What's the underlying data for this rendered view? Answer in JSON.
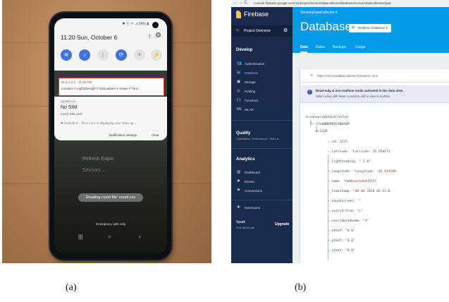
{
  "captions": {
    "a": "(a)",
    "b": "(b)"
  },
  "phone": {
    "status_icons": "✱ ⓝ ᯤ ⊿ 54% ▮",
    "clock": "11:20  Sun, October 6",
    "tiles": [
      "wifi",
      "sound",
      "bluetooth",
      "sync",
      "airplane",
      "flashlight"
    ],
    "notif1_title": "W-w 1.2.1 · 11:05 PM",
    "notif1_text": "Location # LightStrength # Gait pattern # Swipe # Touc...",
    "notif2_source": "System UI",
    "notif2_title": "No SIM",
    "notif2_text": "Insert SIM card",
    "notif3_text": "✱ Android S...   W-w 1.2.1 is displaying over other ap...",
    "notif_settings": "Notification settings",
    "clear": "Clear",
    "bg_text_1": "Refresh    Expor",
    "bg_text_2": "Sensors ...",
    "toast": "Reading count file: count.csv",
    "emergency": "Emergency calls only",
    "nav": [
      "|||",
      "○",
      "‹"
    ]
  },
  "firebase": {
    "browser_url": "console.firebase.google.com/u/1/project/sensorsdatacollector/database/sensorsdatacollector/data",
    "nav_buttons": "← → C",
    "app_title": "Firebase",
    "project_overview": "Project Overview",
    "develop": "Develop",
    "develop_items": [
      "Authentication",
      "Database",
      "Storage",
      "Hosting",
      "Functions",
      "ML Kit"
    ],
    "develop_icons": [
      "👥",
      "▤",
      "▣",
      "◎",
      "(·)",
      "ML"
    ],
    "quality": "Quality",
    "quality_sub": "Crashlytics, Performance, Test La...",
    "analytics": "Analytics",
    "analytics_items": [
      "Dashboard",
      "Events",
      "Conversions"
    ],
    "analytics_icons": [
      "▥",
      "✸",
      "⚑"
    ],
    "extensions": "Extensions",
    "spark": "Spark",
    "spark_sub": "Free $0/month",
    "upgrade": "Upgrade",
    "breadcrumb": "SensorsDataCollector ▾",
    "page_title": "Database",
    "db_selector": "Realtime Database ▾",
    "tabs": [
      "Data",
      "Rules",
      "Backups",
      "Usage"
    ],
    "db_url": "https://sensorsdatacollector.firebaseio.com/",
    "info_title": "Read-only & non-realtime mode activated in the data view",
    "info_sub": "Select a key with fewer records to edit or view in realtime",
    "tree": {
      "root": "sensorsdatacollector",
      "child1": "-LYedBNDPN7pYN8XSM",
      "child2": "1228",
      "fields": [
        {
          "k": "_id:",
          "v": "1225"
        },
        {
          "k": "_latitude:",
          "v": "\"Latitude: 35.958671"
        },
        {
          "k": "_lightreading:",
          "v": "\" 2.0\""
        },
        {
          "k": "_longitude:",
          "v": "\"Longitude: -83.924299"
        },
        {
          "k": "_name:",
          "v": "\"bd0baecbde93555l"
        },
        {
          "k": "_timestamp:",
          "v": "\"09-04-2018 03:52:0"
        },
        {
          "k": "_touchscreen:",
          "v": "\"\""
        },
        {
          "k": "_userid:true:",
          "v": "\"L\""
        },
        {
          "k": "_useridwindname:",
          "v": "\"A\""
        },
        {
          "k": "_xtext:",
          "v": "\"0.0\""
        },
        {
          "k": "_ytext:",
          "v": "\"0.0\""
        },
        {
          "k": "_ztext:",
          "v": "\"0.0\""
        }
      ]
    }
  }
}
